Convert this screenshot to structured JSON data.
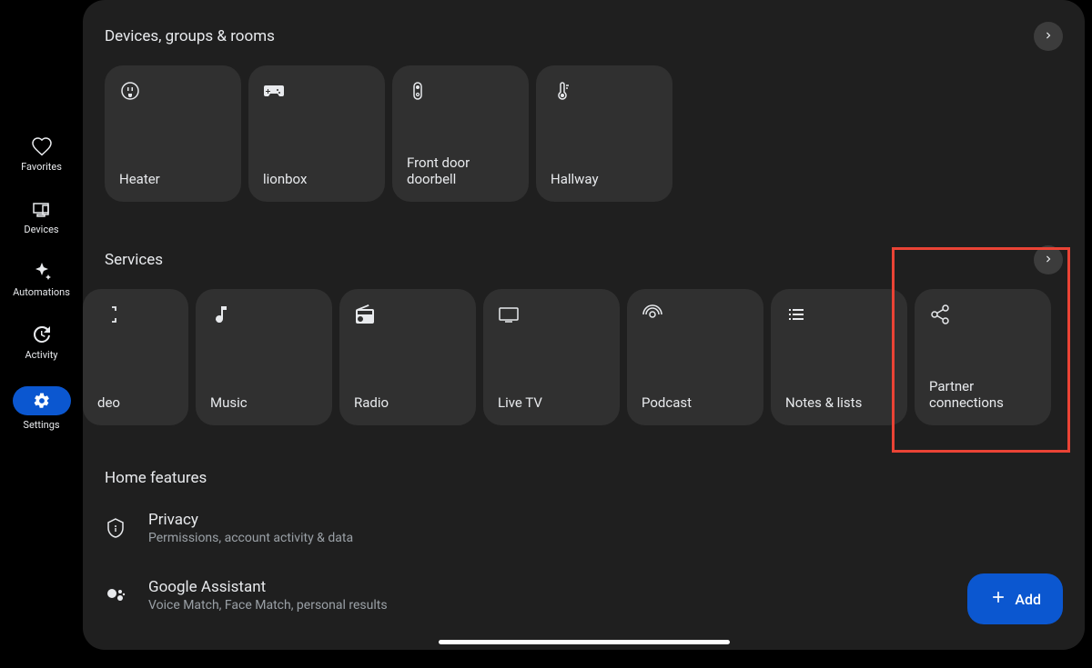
{
  "sidebar": {
    "items": [
      {
        "label": "Favorites",
        "name": "nav-favorites"
      },
      {
        "label": "Devices",
        "name": "nav-devices"
      },
      {
        "label": "Automations",
        "name": "nav-automations"
      },
      {
        "label": "Activity",
        "name": "nav-activity"
      },
      {
        "label": "Settings",
        "name": "nav-settings",
        "active": true
      }
    ]
  },
  "sections": {
    "devices": {
      "title": "Devices, groups & rooms",
      "cards": [
        {
          "label": "Heater",
          "icon": "outlet-icon"
        },
        {
          "label": "lionbox",
          "icon": "gamepad-icon"
        },
        {
          "label": "Front door doorbell",
          "icon": "doorbell-icon"
        },
        {
          "label": "Hallway",
          "icon": "thermostat-icon"
        }
      ]
    },
    "services": {
      "title": "Services",
      "cards": [
        {
          "label": "deo",
          "icon": "video-bracket-icon"
        },
        {
          "label": "Music",
          "icon": "music-note-icon"
        },
        {
          "label": "Radio",
          "icon": "radio-icon"
        },
        {
          "label": "Live TV",
          "icon": "tv-icon"
        },
        {
          "label": "Podcast",
          "icon": "podcast-icon"
        },
        {
          "label": "Notes & lists",
          "icon": "list-icon"
        },
        {
          "label": "Partner connections",
          "icon": "share-icon"
        }
      ]
    },
    "homeFeatures": {
      "title": "Home features",
      "items": [
        {
          "title": "Privacy",
          "sub": "Permissions, account activity & data",
          "icon": "shield-icon"
        },
        {
          "title": "Google Assistant",
          "sub": "Voice Match, Face Match, personal results",
          "icon": "assistant-icon"
        }
      ]
    }
  },
  "fab": {
    "label": "Add"
  },
  "highlight": {
    "target": "service-partner-connections"
  }
}
